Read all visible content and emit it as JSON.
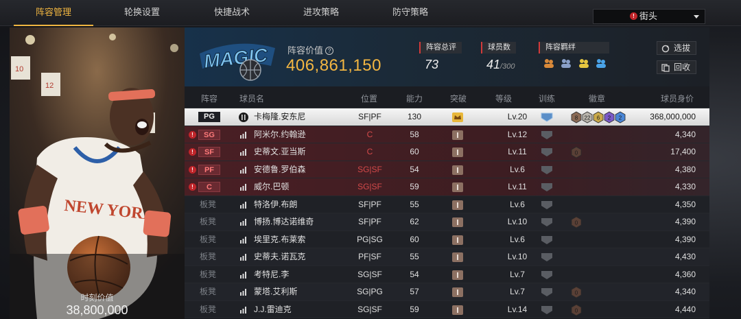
{
  "nav": {
    "tabs": [
      "阵容管理",
      "轮换设置",
      "快捷战术",
      "进攻策略",
      "防守策略"
    ],
    "active_tab": 0,
    "server": "街头",
    "server_badge": "!"
  },
  "portrait": {
    "value_label": "时刻价值",
    "value": "38,800,000",
    "jersey_text": "NEW YORK"
  },
  "team": {
    "logo_text": "MAGIC",
    "lineup_value_label": "阵容价值",
    "help_icon": "?",
    "lineup_value": "406,861,150",
    "overall_label": "阵容总评",
    "overall": "73",
    "player_count_label": "球员数",
    "player_count": "41",
    "player_count_max": "/300",
    "chemistry_label": "阵容羁绊",
    "chemistry_icons": [
      "chem-orange",
      "chem-blue",
      "chem-yellow",
      "chem-blue2"
    ],
    "filter_button": "选拔",
    "recycle_button": "回收"
  },
  "table": {
    "headers": {
      "lineup": "阵容",
      "name": "球员名",
      "position": "位置",
      "ability": "能力",
      "breakthrough": "突破",
      "level": "等级",
      "training": "训练",
      "badges": "徽章",
      "price": "球员身价"
    },
    "bench_label": "板凳",
    "rows": [
      {
        "slot": "PG",
        "kind": "selected",
        "warn": false,
        "name": "卡梅隆.安东尼",
        "pos": "SF|PF",
        "mismatch": false,
        "ability": "130",
        "break": "crown",
        "lvl": "Lv.20",
        "train": "blue",
        "badges": [
          "8",
          "22",
          "6",
          "2",
          "2"
        ],
        "price": "368,000,000"
      },
      {
        "slot": "SG",
        "kind": "starter",
        "warn": true,
        "name": "阿米尔.约翰逊",
        "pos": "C",
        "mismatch": true,
        "ability": "58",
        "break": "1",
        "lvl": "Lv.12",
        "train": "gray",
        "badges": [],
        "price": "4,340"
      },
      {
        "slot": "SF",
        "kind": "starter",
        "warn": true,
        "name": "史蒂文.亚当斯",
        "pos": "C",
        "mismatch": true,
        "ability": "60",
        "break": "1",
        "lvl": "Lv.11",
        "train": "gray",
        "badges": [
          "0"
        ],
        "price": "17,400"
      },
      {
        "slot": "PF",
        "kind": "starter",
        "warn": true,
        "name": "安德鲁.罗伯森",
        "pos": "SG|SF",
        "mismatch": true,
        "ability": "54",
        "break": "1",
        "lvl": "Lv.6",
        "train": "gray",
        "badges": [],
        "price": "4,380"
      },
      {
        "slot": "C",
        "kind": "starter",
        "warn": true,
        "name": "威尔.巴顿",
        "pos": "SG|SF",
        "mismatch": true,
        "ability": "59",
        "break": "1",
        "lvl": "Lv.11",
        "train": "gray",
        "badges": [],
        "price": "4,330"
      },
      {
        "slot": "",
        "kind": "bench",
        "warn": false,
        "name": "特洛伊.布朗",
        "pos": "SF|PF",
        "mismatch": false,
        "ability": "55",
        "break": "1",
        "lvl": "Lv.6",
        "train": "gray",
        "badges": [],
        "price": "4,350"
      },
      {
        "slot": "",
        "kind": "bench",
        "warn": false,
        "name": "博扬.博达诺维奇",
        "pos": "SF|PF",
        "mismatch": false,
        "ability": "62",
        "break": "1",
        "lvl": "Lv.10",
        "train": "gray",
        "badges": [
          "0"
        ],
        "price": "4,390"
      },
      {
        "slot": "",
        "kind": "bench",
        "warn": false,
        "name": "埃里克.布莱索",
        "pos": "PG|SG",
        "mismatch": false,
        "ability": "60",
        "break": "1",
        "lvl": "Lv.6",
        "train": "gray",
        "badges": [],
        "price": "4,390"
      },
      {
        "slot": "",
        "kind": "bench",
        "warn": false,
        "name": "史蒂夫.诺瓦克",
        "pos": "PF|SF",
        "mismatch": false,
        "ability": "55",
        "break": "1",
        "lvl": "Lv.10",
        "train": "gray",
        "badges": [],
        "price": "4,430"
      },
      {
        "slot": "",
        "kind": "bench",
        "warn": false,
        "name": "考特尼.李",
        "pos": "SG|SF",
        "mismatch": false,
        "ability": "54",
        "break": "1",
        "lvl": "Lv.7",
        "train": "gray",
        "badges": [],
        "price": "4,360"
      },
      {
        "slot": "",
        "kind": "bench",
        "warn": false,
        "name": "蒙塔.艾利斯",
        "pos": "SG|PG",
        "mismatch": false,
        "ability": "57",
        "break": "1",
        "lvl": "Lv.7",
        "train": "gray",
        "badges": [
          "0"
        ],
        "price": "4,340"
      },
      {
        "slot": "",
        "kind": "bench",
        "warn": false,
        "name": "J.J.雷迪克",
        "pos": "SG|SF",
        "mismatch": false,
        "ability": "59",
        "break": "1",
        "lvl": "Lv.14",
        "train": "gray",
        "badges": [
          "0"
        ],
        "price": "4,440"
      }
    ]
  },
  "colors": {
    "accent": "#f0b541",
    "starter_row": "#4a1f24",
    "warning_red": "#c0252a",
    "magic_blue": "#2b8fd6"
  }
}
